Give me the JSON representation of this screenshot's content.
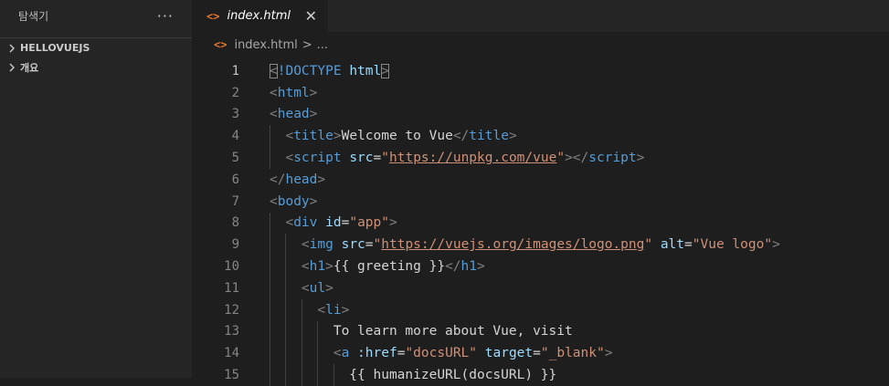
{
  "sidebar": {
    "title": "탐색기",
    "more_label": "···",
    "sections": [
      {
        "label": "HELLOVUEJS"
      },
      {
        "label": "개요"
      }
    ]
  },
  "tab": {
    "icon_glyph": "<>",
    "label": "index.html",
    "close_glyph": "✕"
  },
  "breadcrumb": {
    "icon_glyph": "<>",
    "file": "index.html",
    "sep": ">",
    "more": "..."
  },
  "code": {
    "line_numbers": [
      "1",
      "2",
      "3",
      "4",
      "5",
      "6",
      "7",
      "8",
      "9",
      "10",
      "11",
      "12",
      "13",
      "14",
      "15"
    ],
    "lines": [
      [
        [
          "t",
          "<"
        ],
        [
          "n",
          "!DOCTYPE"
        ],
        [
          "w",
          " "
        ],
        [
          "a",
          "html"
        ],
        [
          "t",
          ">"
        ]
      ],
      [
        [
          "t",
          "<"
        ],
        [
          "n",
          "html"
        ],
        [
          "t",
          ">"
        ]
      ],
      [
        [
          "t",
          "<"
        ],
        [
          "n",
          "head"
        ],
        [
          "t",
          ">"
        ]
      ],
      [
        [
          "w",
          "  "
        ],
        [
          "t",
          "<"
        ],
        [
          "n",
          "title"
        ],
        [
          "t",
          ">"
        ],
        [
          "w",
          "Welcome to Vue"
        ],
        [
          "t",
          "</"
        ],
        [
          "n",
          "title"
        ],
        [
          "t",
          ">"
        ]
      ],
      [
        [
          "w",
          "  "
        ],
        [
          "t",
          "<"
        ],
        [
          "n",
          "script"
        ],
        [
          "w",
          " "
        ],
        [
          "a",
          "src"
        ],
        [
          "w",
          "="
        ],
        [
          "s",
          "\""
        ],
        [
          "u",
          "https://unpkg.com/vue"
        ],
        [
          "s",
          "\""
        ],
        [
          "t",
          "></"
        ],
        [
          "n",
          "script"
        ],
        [
          "t",
          ">"
        ]
      ],
      [
        [
          "t",
          "</"
        ],
        [
          "n",
          "head"
        ],
        [
          "t",
          ">"
        ]
      ],
      [
        [
          "t",
          "<"
        ],
        [
          "n",
          "body"
        ],
        [
          "t",
          ">"
        ]
      ],
      [
        [
          "w",
          "  "
        ],
        [
          "t",
          "<"
        ],
        [
          "n",
          "div"
        ],
        [
          "w",
          " "
        ],
        [
          "a",
          "id"
        ],
        [
          "w",
          "="
        ],
        [
          "s",
          "\"app\""
        ],
        [
          "t",
          ">"
        ]
      ],
      [
        [
          "w",
          "    "
        ],
        [
          "t",
          "<"
        ],
        [
          "n",
          "img"
        ],
        [
          "w",
          " "
        ],
        [
          "a",
          "src"
        ],
        [
          "w",
          "="
        ],
        [
          "s",
          "\""
        ],
        [
          "u",
          "https://vuejs.org/images/logo.png"
        ],
        [
          "s",
          "\""
        ],
        [
          "w",
          " "
        ],
        [
          "a",
          "alt"
        ],
        [
          "w",
          "="
        ],
        [
          "s",
          "\"Vue logo\""
        ],
        [
          "t",
          ">"
        ]
      ],
      [
        [
          "w",
          "    "
        ],
        [
          "t",
          "<"
        ],
        [
          "n",
          "h1"
        ],
        [
          "t",
          ">"
        ],
        [
          "w",
          "{{ greeting }}"
        ],
        [
          "t",
          "</"
        ],
        [
          "n",
          "h1"
        ],
        [
          "t",
          ">"
        ]
      ],
      [
        [
          "w",
          "    "
        ],
        [
          "t",
          "<"
        ],
        [
          "n",
          "ul"
        ],
        [
          "t",
          ">"
        ]
      ],
      [
        [
          "w",
          "      "
        ],
        [
          "t",
          "<"
        ],
        [
          "n",
          "li"
        ],
        [
          "t",
          ">"
        ]
      ],
      [
        [
          "w",
          "        To learn more about Vue, visit"
        ]
      ],
      [
        [
          "w",
          "        "
        ],
        [
          "t",
          "<"
        ],
        [
          "n",
          "a"
        ],
        [
          "w",
          " "
        ],
        [
          "a",
          ":href"
        ],
        [
          "w",
          "="
        ],
        [
          "s",
          "\"docsURL\""
        ],
        [
          "w",
          " "
        ],
        [
          "a",
          "target"
        ],
        [
          "w",
          "="
        ],
        [
          "s",
          "\"_blank\""
        ],
        [
          "t",
          ">"
        ]
      ],
      [
        [
          "w",
          "          {{ humanizeURL(docsURL) }}"
        ]
      ]
    ]
  }
}
